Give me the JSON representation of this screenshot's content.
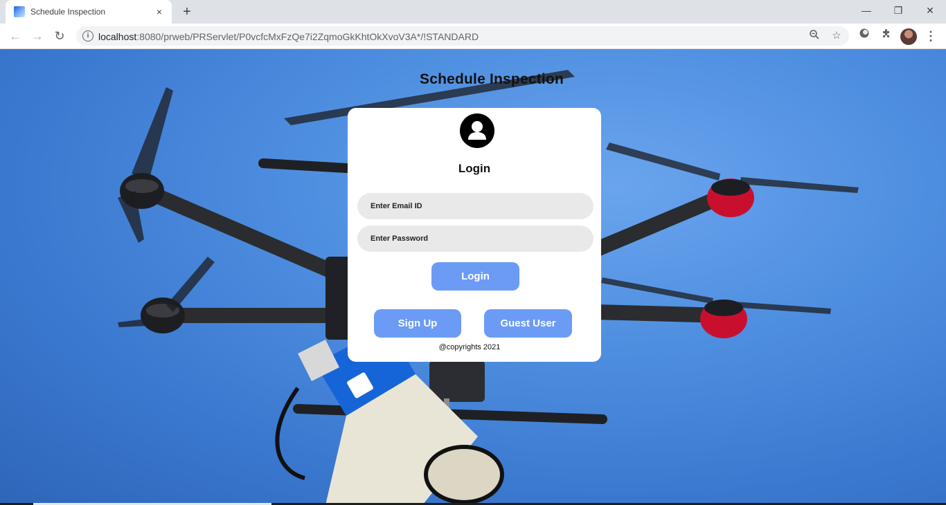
{
  "browser": {
    "tab_title": "Schedule Inspection",
    "tab_close_icon": "×",
    "new_tab_icon": "+",
    "window_controls": {
      "minimize": "—",
      "restore": "❐",
      "close": "✕"
    },
    "nav": {
      "back": "←",
      "forward": "→",
      "reload": "↻"
    },
    "url_host": "localhost",
    "url_rest": ":8080/prweb/PRServlet/P0vcfcMxFzQe7i2ZqmoGkKhtOkXvoV3A*/!STANDARD",
    "info_icon": "i",
    "zoom_icon": "🔍",
    "bookmark_icon": "☆",
    "menu_icon": "⋮"
  },
  "page": {
    "title": "Schedule Inspection"
  },
  "login_card": {
    "heading": "Login",
    "email_placeholder": "Enter Email ID",
    "password_placeholder": "Enter Password",
    "login_button": "Login",
    "signup_button": "Sign Up",
    "guest_button": "Guest User",
    "copyright": "@copyrights 2021"
  },
  "colors": {
    "button": "#6b9bf5",
    "field_bg": "#e9e9e9",
    "sky": "#4f8fe0"
  }
}
